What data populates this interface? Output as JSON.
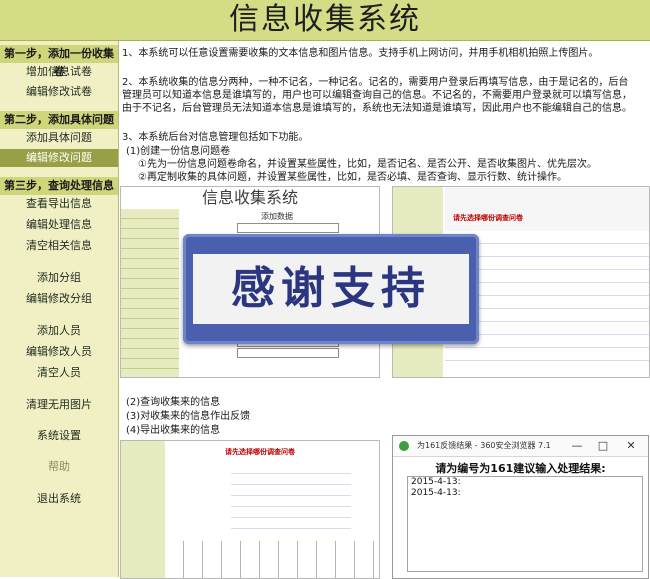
{
  "app": {
    "title": "信息收集系统"
  },
  "sidebar": {
    "items": [
      {
        "label": "第一步，添加一份收集卷",
        "kind": "section"
      },
      {
        "label": "增加信息试卷",
        "kind": "item"
      },
      {
        "label": "编辑修改试卷",
        "kind": "item"
      },
      {
        "label": "第二步，添加具体问题",
        "kind": "section"
      },
      {
        "label": "添加具体问题",
        "kind": "item"
      },
      {
        "label": "编辑修改问题",
        "kind": "active"
      },
      {
        "label": "第三步，查询处理信息",
        "kind": "section"
      },
      {
        "label": "查看导出信息",
        "kind": "item"
      },
      {
        "label": "编辑处理信息",
        "kind": "item"
      },
      {
        "label": "清空相关信息",
        "kind": "item"
      },
      {
        "label": "添加分组",
        "kind": "item"
      },
      {
        "label": "编辑修改分组",
        "kind": "item"
      },
      {
        "label": "添加人员",
        "kind": "item"
      },
      {
        "label": "编辑修改人员",
        "kind": "item"
      },
      {
        "label": "清空人员",
        "kind": "item"
      },
      {
        "label": "清理无用图片",
        "kind": "item"
      },
      {
        "label": "系统设置",
        "kind": "item"
      },
      {
        "label": "帮助",
        "kind": "dim"
      },
      {
        "label": "退出系统",
        "kind": "item"
      }
    ]
  },
  "main": {
    "p1": "1、本系统可以任意设置需要收集的文本信息和图片信息。支持手机上网访问，并用手机相机拍照上传图片。",
    "p2_l1": "2、本系统收集的信息分两种，一种不记名，一种记名。记名的，需要用户登录后再填写信息，由于是记名的，后台",
    "p2_l2": "管理员可以知道本信息是谁填写的，用户也可以编辑查询自己的信息。不记名的，不需要用户登录就可以填写信息，",
    "p2_l3": "由于不记名，后台管理员无法知道本信息是谁填写的，系统也无法知道是谁填写，因此用户也不能编辑自己的信息。",
    "p3": "3、本系统后台对信息管理包括如下功能。",
    "p3_1": "(1)创建一份信息问题卷",
    "p3_1a": "①先为一份信息问题卷命名，并设置某些属性，比如，是否记名、是否公开、是否收集图片、优先层次。",
    "p3_1b": "②再定制收集的具体问题，并设置某些属性，比如，是否必填、是否查询、显示行数、统计操作。",
    "p3_2": "(2)查询收集来的信息",
    "p3_3": "(3)对收集来的信息作出反馈",
    "p3_4": "(4)导出收集来的信息"
  },
  "shot1": {
    "title": "信息收集系统",
    "form_title": "添加数据",
    "side": [
      "",
      "",
      "",
      "",
      "",
      "",
      "",
      "",
      "",
      "",
      "",
      "",
      ""
    ]
  },
  "shot2": {
    "header": "请先选择哪份调查问卷"
  },
  "shot3": {
    "header": "请先选择哪份调查问卷"
  },
  "banner": {
    "text": "感谢支持"
  },
  "feedback_window": {
    "title": "为161反馈结果 - 360安全浏览器 7.1",
    "heading": "请为编号为161建议输入处理结果:",
    "lines": [
      "2015-4-13:",
      "2015-4-13:"
    ],
    "controls": {
      "minimize": "—",
      "maximize": "□",
      "close": "✕"
    }
  }
}
